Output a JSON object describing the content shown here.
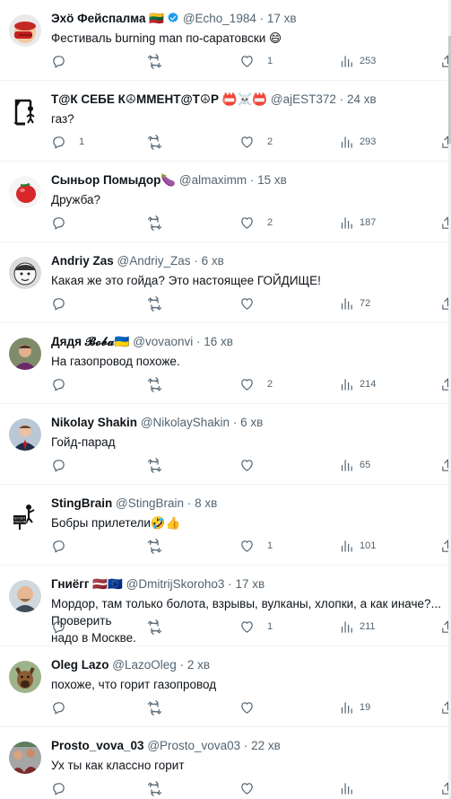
{
  "tweets": [
    {
      "name": "Эхö Фейспалма 🇱🇹",
      "verified": true,
      "handle": "@Echo_1984",
      "dot": "·",
      "time": "17 хв",
      "text": "Фестиваль burning man по-саратовски 😄",
      "reply": "",
      "rt": "",
      "like": "1",
      "views": "253",
      "avatar": "facepalm-avatar"
    },
    {
      "name": "Т@К СЕБЕ К☮ММЕНТ@Т☮Р 📛☠️📛",
      "verified": false,
      "handle": "@ajEST372",
      "dot": "·",
      "time": "24 хв",
      "text": "газ?",
      "reply": "1",
      "rt": "",
      "like": "2",
      "views": "293",
      "avatar": "gallows-avatar"
    },
    {
      "name": "Сыньор Помыдор🍆",
      "verified": false,
      "handle": "@almaximm",
      "dot": "·",
      "time": "15 хв",
      "text": "Дружба?",
      "reply": "",
      "rt": "",
      "like": "2",
      "views": "187",
      "avatar": "tomato-avatar"
    },
    {
      "name": "Andriy Zas",
      "verified": false,
      "handle": "@Andriy_Zas",
      "dot": "·",
      "time": "6 хв",
      "text": "Какая же это гойда? Это настоящее ГОЙДИЩЕ!",
      "reply": "",
      "rt": "",
      "like": "",
      "views": "72",
      "avatar": "cartoon-face-avatar"
    },
    {
      "name": "Дядя 𝓑𝓸𝓫𝓪🇺🇦",
      "verified": false,
      "handle": "@vovaonvi",
      "dot": "·",
      "time": "16 хв",
      "text": "На газопровод похоже.",
      "reply": "",
      "rt": "",
      "like": "2",
      "views": "214",
      "avatar": "man-photo-avatar"
    },
    {
      "name": "Nikolay Shakin",
      "verified": false,
      "handle": "@NikolayShakin",
      "dot": "·",
      "time": "6 хв",
      "text": "Гойд-парад",
      "reply": "",
      "rt": "",
      "like": "",
      "views": "65",
      "avatar": "suit-man-avatar"
    },
    {
      "name": "StingBrain",
      "verified": false,
      "handle": "@StingBrain",
      "dot": "·",
      "time": "8 хв",
      "text": "Бобры прилетели🤣👍",
      "reply": "",
      "rt": "",
      "like": "1",
      "views": "101",
      "avatar": "do-not-touch-avatar"
    },
    {
      "name": "Гниёгг 🇱🇻🇪🇺",
      "verified": false,
      "handle": "@DmitrijSkoroho3",
      "dot": "·",
      "time": "17 хв",
      "text": "Мордор, там только болота, взрывы, вулканы, хлопки, а как иначе?... Проверить\nнадо в Москве.",
      "reply": "",
      "rt": "",
      "like": "1",
      "views": "211",
      "avatar": "bald-man-avatar"
    },
    {
      "name": "Oleg Lazo",
      "verified": false,
      "handle": "@LazoOleg",
      "dot": "·",
      "time": "2 хв",
      "text": "похоже, что горит газопровод",
      "reply": "",
      "rt": "",
      "like": "",
      "views": "19",
      "avatar": "dog-avatar"
    },
    {
      "name": "Prosto_vova_03",
      "verified": false,
      "handle": "@Prosto_vova03",
      "dot": "·",
      "time": "22 хв",
      "text": "Ух ты как классно горит",
      "reply": "",
      "rt": "",
      "like": "",
      "views": "",
      "avatar": "crowd-avatar"
    }
  ],
  "icons": {
    "reply": "reply-icon",
    "retweet": "retweet-icon",
    "like": "heart-icon",
    "views": "views-icon",
    "share": "share-icon"
  },
  "colors": {
    "text": "#0f1419",
    "muted": "#536471",
    "verified": "#1d9bf0",
    "divider": "#eff3f4"
  }
}
